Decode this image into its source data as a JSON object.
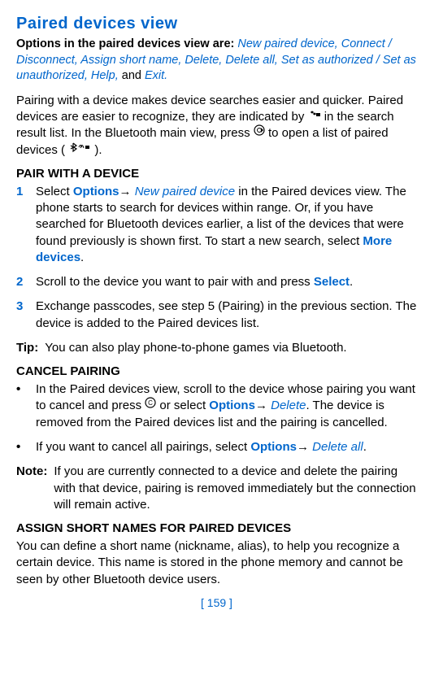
{
  "title": "Paired devices view",
  "optionsIntro": {
    "boldPart": "Options in the paired devices view are:",
    "list": "New paired device, Connect / Disconnect, Assign short name, Delete, Delete all, Set as authorized / Set as unauthorized, Help,",
    "andWord": " and ",
    "exit": "Exit."
  },
  "intro": {
    "part1": "Pairing with a device makes device searches easier and quicker. Paired devices are easier to recognize, they are indicated by ",
    "part2": " in the search result list. In the Bluetooth main view, press ",
    "part3": " to open a list of paired devices (",
    "part4": ")."
  },
  "pairHead": "PAIR WITH A DEVICE",
  "steps": {
    "s1a": "Select ",
    "s1b": "Options",
    "s1arrow": "→ ",
    "s1c": "New paired device",
    "s1d": " in the Paired devices view. The phone starts to search for devices within range. Or, if you have searched for Bluetooth devices earlier, a list of the devices that were found previously is shown first. To start a new search, select ",
    "s1e": "More devices",
    "s1f": ".",
    "s2a": "Scroll to the device you want to pair with and press ",
    "s2b": "Select",
    "s2c": ".",
    "s3": "Exchange passcodes, see step 5 (Pairing) in the previous section. The device is added to the Paired devices list."
  },
  "tipLabel": "Tip:",
  "tipText": "You can also play phone-to-phone games via Bluetooth.",
  "cancelHead": "CANCEL PAIRING",
  "cancel": {
    "b1a": "In the Paired devices view, scroll to the device whose pairing you want to cancel and press ",
    "b1b": " or select ",
    "b1c": "Options",
    "b1arrow": "→ ",
    "b1d": "Delete",
    "b1e": ". The device is removed from the Paired devices list and the pairing is cancelled.",
    "b2a": "If you want to cancel all pairings, select ",
    "b2b": "Options",
    "b2arrow": "→ ",
    "b2c": "Delete all",
    "b2d": "."
  },
  "noteLabel": "Note:",
  "noteText": "If you are currently connected to a device and delete the pairing with that device, pairing is removed immediately but the connection will remain active.",
  "assignHead": "ASSIGN SHORT NAMES FOR PAIRED DEVICES",
  "assignPara": "You can define a short name (nickname, alias), to help you recognize a certain device. This name is stored in the phone memory and cannot be seen by other Bluetooth device users.",
  "pageNum": "[ 159 ]"
}
